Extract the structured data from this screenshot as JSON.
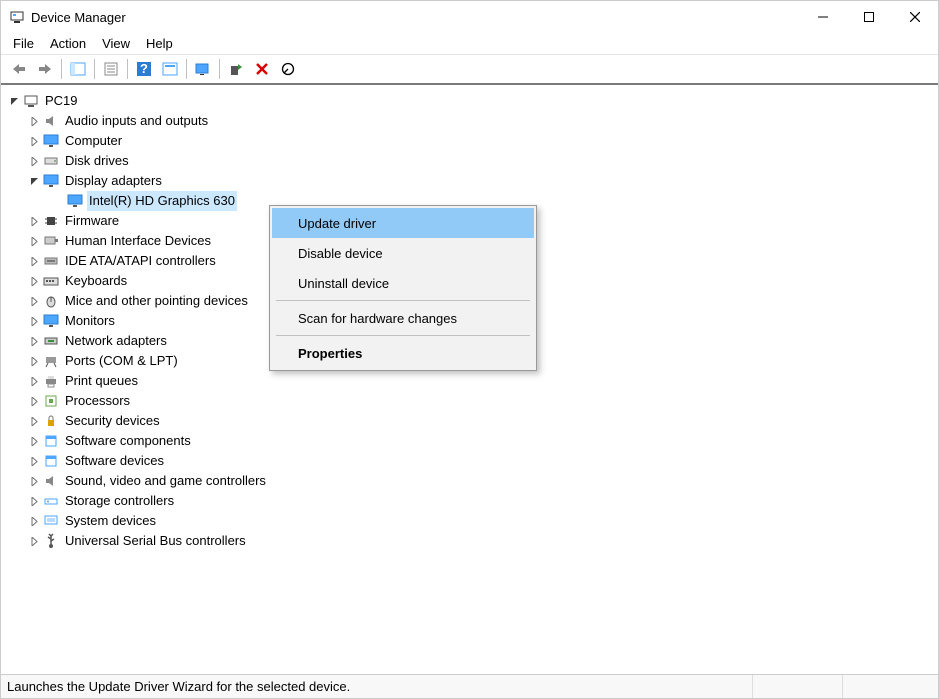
{
  "window": {
    "title": "Device Manager"
  },
  "menu": {
    "file": "File",
    "action": "Action",
    "view": "View",
    "help": "Help"
  },
  "tree": {
    "root": "PC19",
    "items": [
      {
        "label": "Audio inputs and outputs",
        "icon": "speaker"
      },
      {
        "label": "Computer",
        "icon": "monitor"
      },
      {
        "label": "Disk drives",
        "icon": "disk"
      },
      {
        "label": "Display adapters",
        "icon": "monitor",
        "expanded": true,
        "children": [
          {
            "label": "Intel(R) HD Graphics 630",
            "icon": "monitor",
            "selected": true
          }
        ]
      },
      {
        "label": "Firmware",
        "icon": "chip"
      },
      {
        "label": "Human Interface Devices",
        "icon": "hid"
      },
      {
        "label": "IDE ATA/ATAPI controllers",
        "icon": "ide"
      },
      {
        "label": "Keyboards",
        "icon": "keyboard"
      },
      {
        "label": "Mice and other pointing devices",
        "icon": "mouse"
      },
      {
        "label": "Monitors",
        "icon": "monitor"
      },
      {
        "label": "Network adapters",
        "icon": "network"
      },
      {
        "label": "Ports (COM & LPT)",
        "icon": "port"
      },
      {
        "label": "Print queues",
        "icon": "printer"
      },
      {
        "label": "Processors",
        "icon": "cpu"
      },
      {
        "label": "Security devices",
        "icon": "security"
      },
      {
        "label": "Software components",
        "icon": "software"
      },
      {
        "label": "Software devices",
        "icon": "software"
      },
      {
        "label": "Sound, video and game controllers",
        "icon": "speaker"
      },
      {
        "label": "Storage controllers",
        "icon": "storage"
      },
      {
        "label": "System devices",
        "icon": "system"
      },
      {
        "label": "Universal Serial Bus controllers",
        "icon": "usb"
      }
    ]
  },
  "context_menu": {
    "update": "Update driver",
    "disable": "Disable device",
    "uninstall": "Uninstall device",
    "scan": "Scan for hardware changes",
    "properties": "Properties"
  },
  "status": {
    "text": "Launches the Update Driver Wizard for the selected device."
  },
  "icons": {
    "computer": "#3a6ea5",
    "monitor": "#4da6ff",
    "disk": "#777",
    "chip": "#555",
    "keyboard": "#444",
    "mouse": "#444",
    "network": "#3a8f3a",
    "port": "#555",
    "printer": "#555",
    "cpu": "#6aa84f",
    "security": "#d9a400",
    "software": "#4da6ff",
    "speaker": "#777",
    "storage": "#4da6ff",
    "system": "#4da6ff",
    "usb": "#555",
    "hid": "#777",
    "ide": "#777"
  }
}
